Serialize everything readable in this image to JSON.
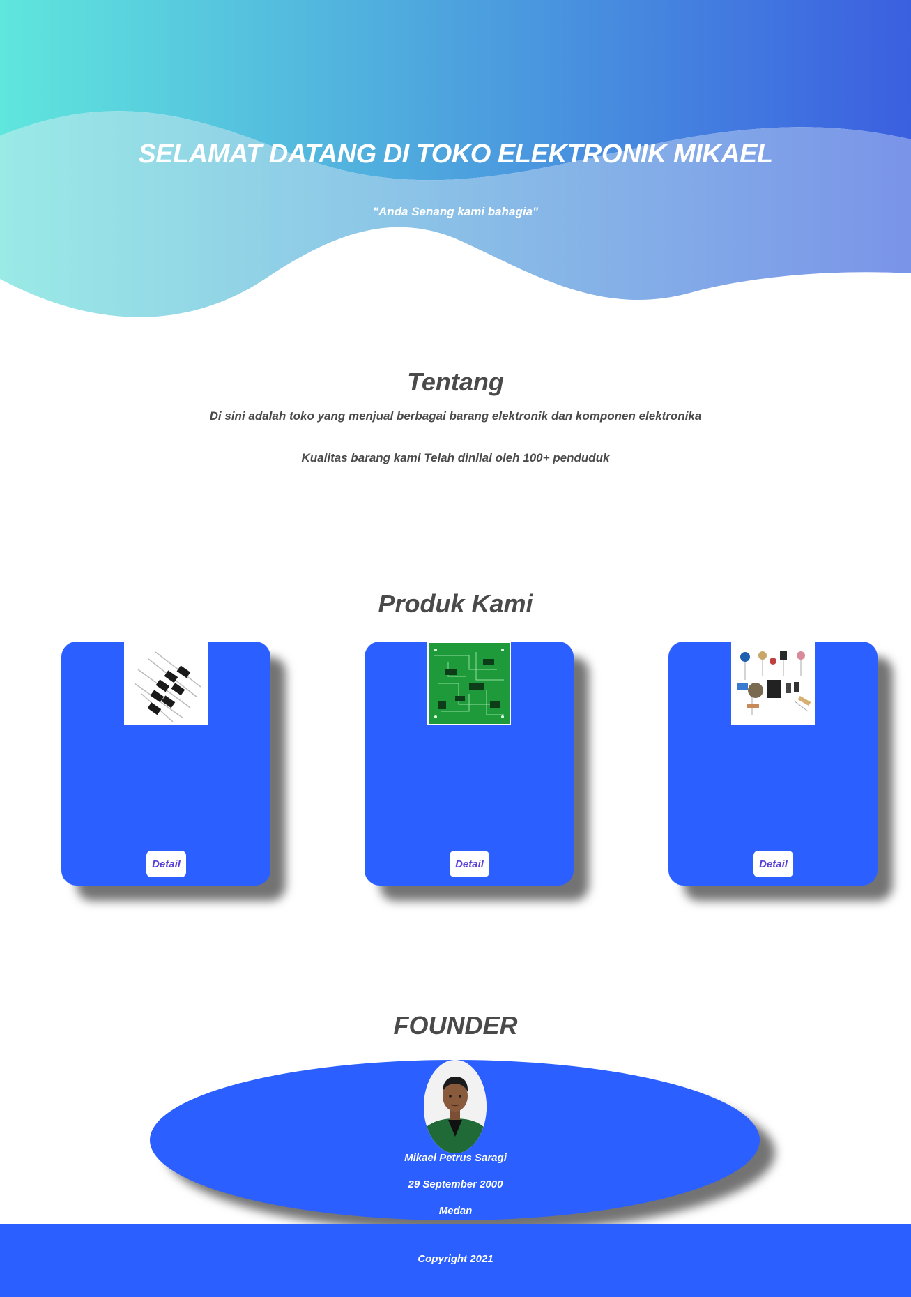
{
  "hero": {
    "title": "SELAMAT DATANG DI TOKO ELEKTRONIK MIKAEL",
    "tagline": "\"Anda Senang kami bahagia\""
  },
  "about": {
    "heading": "Tentang",
    "line1": "Di sini adalah toko yang menjual berbagai barang elektronik dan komponen elektronika",
    "line2": "Kualitas barang kami Telah dinilai oleh 100+ penduduk"
  },
  "products": {
    "heading": "Produk Kami",
    "items": [
      {
        "image": "diodes-image",
        "button_label": "Detail"
      },
      {
        "image": "pcb-board-image",
        "button_label": "Detail"
      },
      {
        "image": "electronic-components-image",
        "button_label": "Detail"
      }
    ]
  },
  "founder": {
    "heading": "FOUNDER",
    "name": "Mikael Petrus Saragi",
    "birth_date": "29 September 2000",
    "city": "Medan"
  },
  "footer": {
    "copyright": "Copyright 2021"
  },
  "colors": {
    "accent_blue": "#2b5fff",
    "hero_gradient_start": "#5ee7df",
    "hero_gradient_end": "#3b5fe0",
    "button_text": "#5a3fd8",
    "heading_text": "#4a4a4a"
  }
}
